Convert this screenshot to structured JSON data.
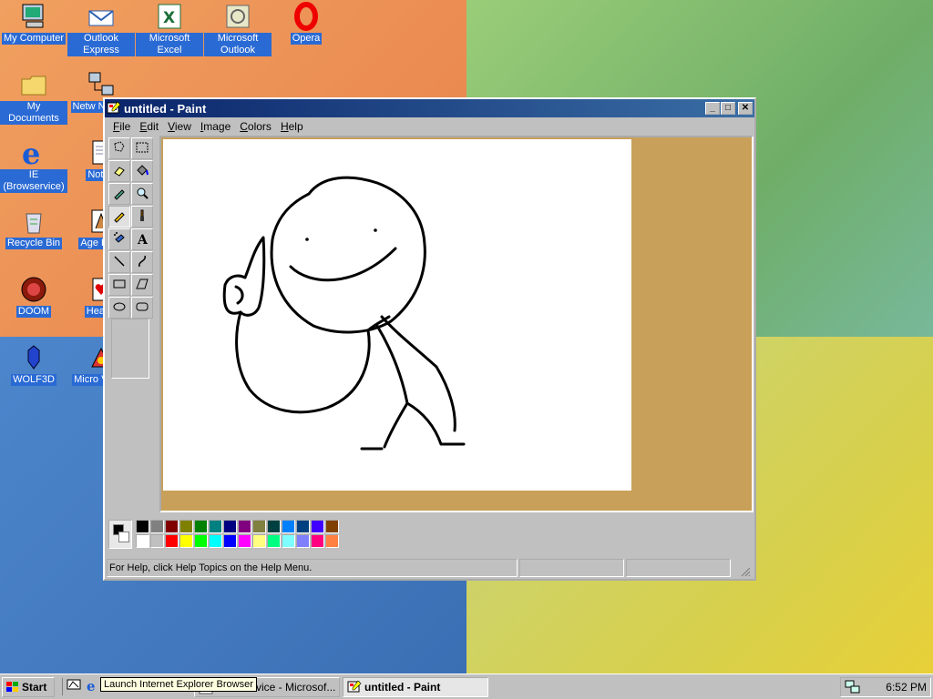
{
  "desktop": {
    "icons": [
      {
        "label": "My Computer",
        "icon": "computer-icon"
      },
      {
        "label": "Outlook Express",
        "icon": "outlook-express-icon"
      },
      {
        "label": "Microsoft Excel",
        "icon": "excel-icon"
      },
      {
        "label": "Microsoft Outlook",
        "icon": "outlook-icon"
      },
      {
        "label": "Opera",
        "icon": "opera-icon"
      },
      {
        "label": "My Documents",
        "icon": "folder-icon"
      },
      {
        "label": "Netw Neighb",
        "icon": "network-icon"
      },
      {
        "label": "IE (Browservice)",
        "icon": "internet-explorer-icon"
      },
      {
        "label": "Notep",
        "icon": "notepad-icon"
      },
      {
        "label": "Recycle Bin",
        "icon": "recycle-bin-icon"
      },
      {
        "label": "Age Emp",
        "icon": "age-of-empires-icon"
      },
      {
        "label": "DOOM",
        "icon": "doom-icon"
      },
      {
        "label": "Hearts",
        "icon": "hearts-icon"
      },
      {
        "label": "WOLF3D",
        "icon": "wolf3d-icon"
      },
      {
        "label": "Micro Visual",
        "icon": "visual-studio-icon"
      }
    ]
  },
  "paint": {
    "title": "untitled - Paint",
    "menu": [
      "File",
      "Edit",
      "View",
      "Image",
      "Colors",
      "Help"
    ],
    "menu_underline": [
      "F",
      "E",
      "V",
      "I",
      "C",
      "H"
    ],
    "tools": [
      "free-form-select-icon",
      "select-icon",
      "eraser-icon",
      "fill-bucket-icon",
      "color-picker-icon",
      "magnifier-icon",
      "pencil-icon",
      "brush-icon",
      "airbrush-icon",
      "text-icon",
      "line-icon",
      "curve-icon",
      "rectangle-icon",
      "polygon-icon",
      "ellipse-icon",
      "rounded-rectangle-icon"
    ],
    "selected_tool": "pencil-icon",
    "workspace_color": "#c9a059",
    "palette_top": [
      "#000000",
      "#808080",
      "#800000",
      "#808000",
      "#008000",
      "#008080",
      "#000080",
      "#800080",
      "#808040",
      "#004040",
      "#0080ff",
      "#004080",
      "#4000ff",
      "#804000"
    ],
    "palette_bottom": [
      "#ffffff",
      "#c0c0c0",
      "#ff0000",
      "#ffff00",
      "#00ff00",
      "#00ffff",
      "#0000ff",
      "#ff00ff",
      "#ffff80",
      "#00ff80",
      "#80ffff",
      "#8080ff",
      "#ff0080",
      "#ff8040"
    ],
    "foreground_color": "#000000",
    "background_color": "#ffffff",
    "status_text": "For Help, click Help Topics on the Help Menu."
  },
  "taskbar": {
    "start_label": "Start",
    "tooltip": "Launch Internet Explorer Browser",
    "tasks": [
      {
        "label": "Browservice - Microsof...",
        "icon": "internet-explorer-icon",
        "active": false
      },
      {
        "label": "untitled - Paint",
        "icon": "paint-icon",
        "active": true
      }
    ],
    "clock": "6:52 PM"
  },
  "colors": {
    "titlebar": "#0a246a",
    "selection": "#2a6ad4"
  }
}
